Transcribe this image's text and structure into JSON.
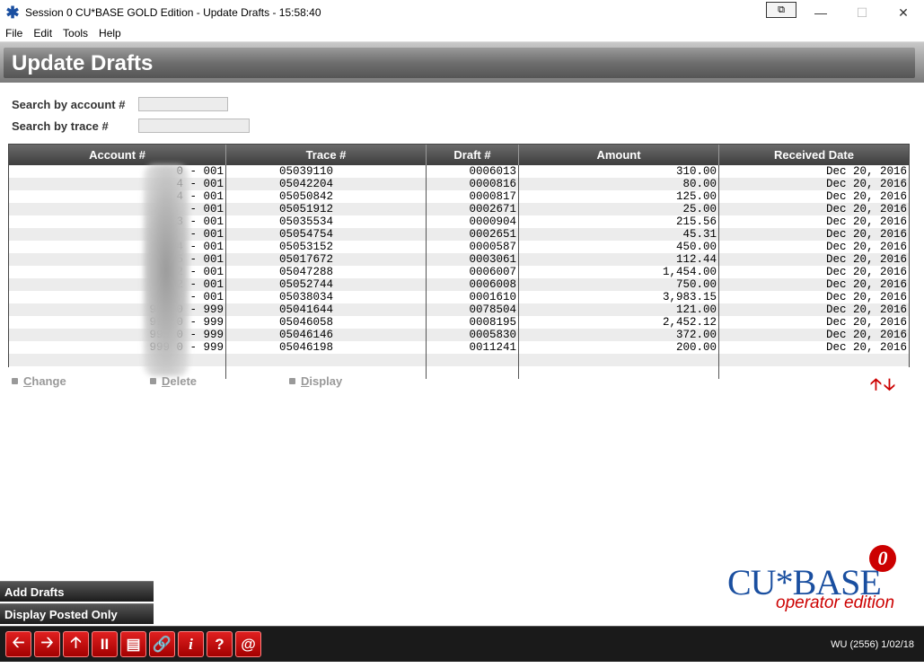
{
  "window": {
    "title": "Session 0 CU*BASE GOLD Edition - Update Drafts - 15:58:40",
    "minimize": "—",
    "maximize": "☐",
    "close": "✕",
    "restore_glyph": "⧉"
  },
  "menu": [
    "File",
    "Edit",
    "Tools",
    "Help"
  ],
  "page_title": "Update Drafts",
  "search": {
    "account_label": "Search by account #",
    "account_value": "",
    "trace_label": "Search by trace #",
    "trace_value": ""
  },
  "table": {
    "columns": [
      "Account #",
      "Trace #",
      "Draft #",
      "Amount",
      "Received Date"
    ],
    "rows": [
      {
        "account": "0 - 001",
        "trace": "05039110",
        "draft": "0006013",
        "amount": "310.00",
        "date": "Dec 20, 2016"
      },
      {
        "account": "4 - 001",
        "trace": "05042204",
        "draft": "0000816",
        "amount": "80.00",
        "date": "Dec 20, 2016"
      },
      {
        "account": "4 - 001",
        "trace": "05050842",
        "draft": "0000817",
        "amount": "125.00",
        "date": "Dec 20, 2016"
      },
      {
        "account": "- 001",
        "trace": "05051912",
        "draft": "0002671",
        "amount": "25.00",
        "date": "Dec 20, 2016"
      },
      {
        "account": "3 - 001",
        "trace": "05035534",
        "draft": "0000904",
        "amount": "215.56",
        "date": "Dec 20, 2016"
      },
      {
        "account": "- 001",
        "trace": "05054754",
        "draft": "0002651",
        "amount": "45.31",
        "date": "Dec 20, 2016"
      },
      {
        "account": "4 - 001",
        "trace": "05053152",
        "draft": "0000587",
        "amount": "450.00",
        "date": "Dec 20, 2016"
      },
      {
        "account": "5 - 001",
        "trace": "05017672",
        "draft": "0003061",
        "amount": "112.44",
        "date": "Dec 20, 2016"
      },
      {
        "account": "2 - 001",
        "trace": "05047288",
        "draft": "0006007",
        "amount": "1,454.00",
        "date": "Dec 20, 2016"
      },
      {
        "account": "2 - 001",
        "trace": "05052744",
        "draft": "0006008",
        "amount": "750.00",
        "date": "Dec 20, 2016"
      },
      {
        "account": "- 001",
        "trace": "05038034",
        "draft": "0001610",
        "amount": "3,983.15",
        "date": "Dec 20, 2016"
      },
      {
        "account": "999 0 - 999",
        "trace": "05041644",
        "draft": "0078504",
        "amount": "121.00",
        "date": "Dec 20, 2016"
      },
      {
        "account": "999 0 - 999",
        "trace": "05046058",
        "draft": "0008195",
        "amount": "2,452.12",
        "date": "Dec 20, 2016"
      },
      {
        "account": "999 0 - 999",
        "trace": "05046146",
        "draft": "0005830",
        "amount": "372.00",
        "date": "Dec 20, 2016"
      },
      {
        "account": "999 0 - 999",
        "trace": "05046198",
        "draft": "0011241",
        "amount": "200.00",
        "date": "Dec 20, 2016"
      }
    ]
  },
  "actions": [
    {
      "first": "C",
      "rest": "hange"
    },
    {
      "first": "D",
      "rest": "elete"
    },
    {
      "first": "D",
      "rest": "isplay"
    }
  ],
  "scroll_arrows": {
    "up": "🡡",
    "down": "🡣"
  },
  "side_buttons": [
    "Add Drafts",
    "Display Posted Only"
  ],
  "toolbar": {
    "buttons": [
      "🡠",
      "🡢",
      "🡡",
      "II",
      "▤",
      "🔗",
      "i",
      "?",
      "@"
    ]
  },
  "logo": {
    "brand": "CU*BASE",
    "gear_text": "0",
    "subtitle": "operator edition"
  },
  "status_text": "WU (2556) 1/02/18",
  "colors": {
    "accent": "#cc0000",
    "brand_blue": "#1a4fa0",
    "header_gray": "#6e6e6e"
  }
}
